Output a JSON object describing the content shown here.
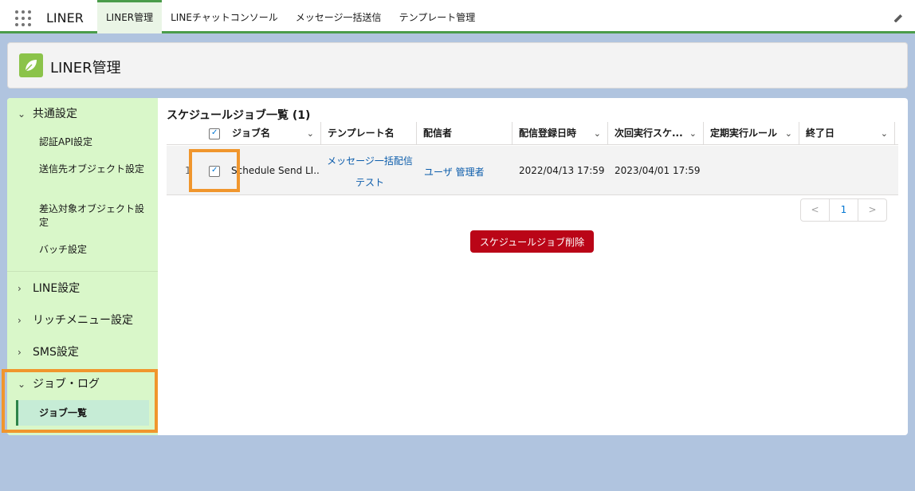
{
  "app": {
    "name": "LINER"
  },
  "nav": {
    "tabs": [
      {
        "label": "LINER管理"
      },
      {
        "label": "LINEチャットコンソール"
      },
      {
        "label": "メッセージ一括送信"
      },
      {
        "label": "テンプレート管理"
      }
    ]
  },
  "header": {
    "title": "LINER管理"
  },
  "sidebar": {
    "common": {
      "label": "共通設定"
    },
    "common_items": [
      {
        "label": "認証API設定"
      },
      {
        "label": "送信先オブジェクト設定"
      },
      {
        "label": "差込対象オブジェクト設定"
      },
      {
        "label": "バッチ設定"
      }
    ],
    "line": {
      "label": "LINE設定"
    },
    "richmenu": {
      "label": "リッチメニュー設定"
    },
    "sms": {
      "label": "SMS設定"
    },
    "joblog": {
      "label": "ジョブ・ログ"
    },
    "active_item": {
      "label": "ジョブ一覧"
    }
  },
  "list": {
    "title": "スケジュールジョブ一覧 (1)",
    "columns": [
      {
        "label": "ジョブ名"
      },
      {
        "label": "テンプレート名"
      },
      {
        "label": "配信者"
      },
      {
        "label": "配信登録日時"
      },
      {
        "label": "次回実行スケ..."
      },
      {
        "label": "定期実行ルール"
      },
      {
        "label": "終了日"
      }
    ],
    "rows": [
      {
        "num": "1",
        "job_name": "Schedule Send LI...",
        "template_line1": "メッセージ一括配信",
        "template_line2": "テスト",
        "sender": "ユーザ 管理者",
        "registered": "2022/04/13 17:59",
        "next_run": "2023/04/01 17:59",
        "rule": "",
        "end_date": ""
      }
    ],
    "pager": {
      "prev": "<",
      "page": "1",
      "next": ">"
    },
    "delete_button": "スケジュールジョブ削除"
  }
}
